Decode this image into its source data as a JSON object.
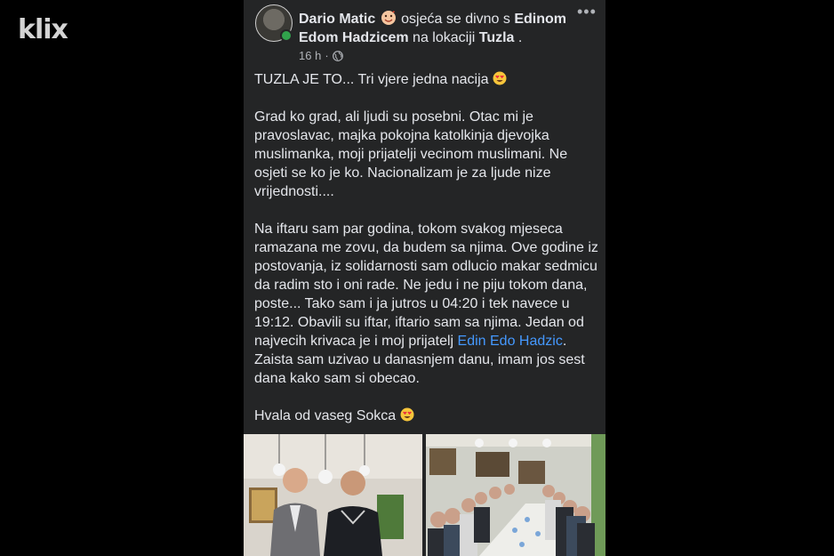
{
  "watermark": {
    "text": "klix"
  },
  "post": {
    "author": "Dario Matic",
    "feeling_text": " osjeća se divno s ",
    "tagged_name": "Edinom Edom Hadzicem",
    "location_prefix": " na lokaciji ",
    "location": "Tuzla",
    "location_suffix": ".",
    "timestamp": "16 h",
    "separator": "·",
    "more_label": "•••",
    "paragraphs": {
      "p1": "TUZLA JE TO... Tri vjere jedna nacija ",
      "p2": "Grad ko grad, ali ljudi su posebni. Otac mi je pravoslavac, majka pokojna katolkinja djevojka muslimanka, moji prijatelji vecinom muslimani. Ne osjeti se ko je ko. Nacionalizam je za ljude nize vrijednosti....",
      "p3_start": "Na iftaru sam par godina, tokom svakog mjeseca ramazana me zovu, da budem sa njima. Ove godine iz postovanja, iz solidarnosti sam odlucio makar sedmicu da radim sto i oni rade. Ne jedu i ne piju tokom dana, poste... Tako sam i ja jutros u 04:20 i tek navece u 19:12. Obavili su iftar, iftario sam sa njima. Jedan od najvecih krivaca je i moj prijatelj ",
      "p3_mention": "Edin Edo Hadzic",
      "p3_end": ". Zaista sam uzivao u danasnjem danu, imam jos sest dana kako sam si obecao.",
      "p4": "Hvala od vaseg Sokca "
    }
  },
  "colors": {
    "card_bg": "#242526",
    "text_primary": "#e4e6eb",
    "text_secondary": "#b0b3b8",
    "mention": "#4599ff",
    "online": "#31a24c"
  }
}
